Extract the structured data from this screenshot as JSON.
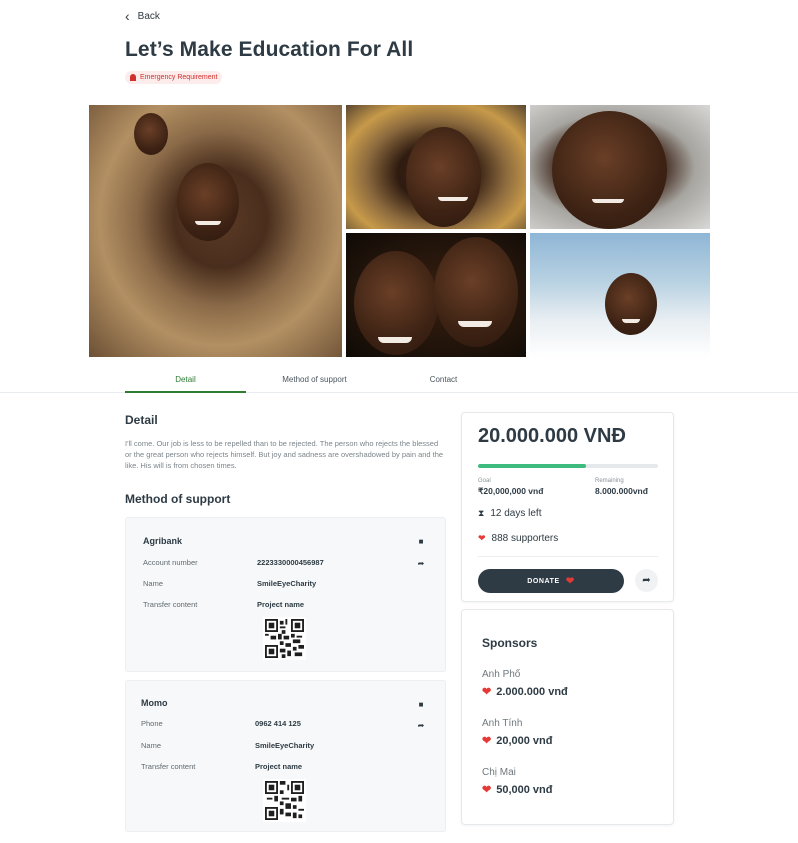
{
  "nav": {
    "back_label": "Back"
  },
  "page": {
    "title": "Let’s Make Education For All",
    "badge": "Emergency Requirement"
  },
  "gallery": {
    "photos": [
      "girl-smiling-photo",
      "braided-girl-photo",
      "boy-portrait-photo",
      "laughing-children-photo",
      "schoolboy-photo"
    ]
  },
  "tabs": [
    {
      "label": "Detail",
      "active": true
    },
    {
      "label": "Method of support",
      "active": false
    },
    {
      "label": "Contact",
      "active": false
    }
  ],
  "detail": {
    "heading": "Detail",
    "text": "I'll come. Our job is less to be repelled than to be rejected. The person who rejects the blessed or the great person who rejects himself. But joy and sadness are overshadowed by pain and the like. His will is from chosen times."
  },
  "support": {
    "heading": "Method of support",
    "methods": [
      {
        "name": "Agribank",
        "rows": [
          {
            "label": "Account number",
            "value": "2223330000456987"
          },
          {
            "label": "Name",
            "value": "SmileEyeCharity"
          },
          {
            "label": "Transfer content",
            "value": "Project name"
          }
        ],
        "icons": [
          "copy-icon",
          "share-icon"
        ]
      },
      {
        "name": "Momo",
        "rows": [
          {
            "label": "Phone",
            "value": "0962 414 125"
          },
          {
            "label": "Name",
            "value": "SmileEyeCharity"
          },
          {
            "label": "Transfer content",
            "value": "Project name"
          }
        ],
        "icons": [
          "copy-icon",
          "share-icon"
        ]
      }
    ]
  },
  "fundraising": {
    "amount": "20.000.000 VNĐ",
    "progress_fraction": 0.6,
    "goal_label": "Goal",
    "goal_value": "₹20,000,000 vnđ",
    "remaining_label": "Remaining",
    "remaining_value": "8.000.000vnđ",
    "days_left": "12 days left",
    "supporters": "888 supporters",
    "donate_label": "DONATE",
    "colors": {
      "accent": "#3dba7e",
      "dark": "#2e3b44",
      "heart": "#e53935"
    }
  },
  "sponsors": {
    "heading": "Sponsors",
    "items": [
      {
        "name": "Anh Phố",
        "amount": "2.000.000 vnđ"
      },
      {
        "name": "Anh Tính",
        "amount": "20,000 vnđ"
      },
      {
        "name": "Chị Mai",
        "amount": "50,000 vnđ"
      }
    ]
  }
}
